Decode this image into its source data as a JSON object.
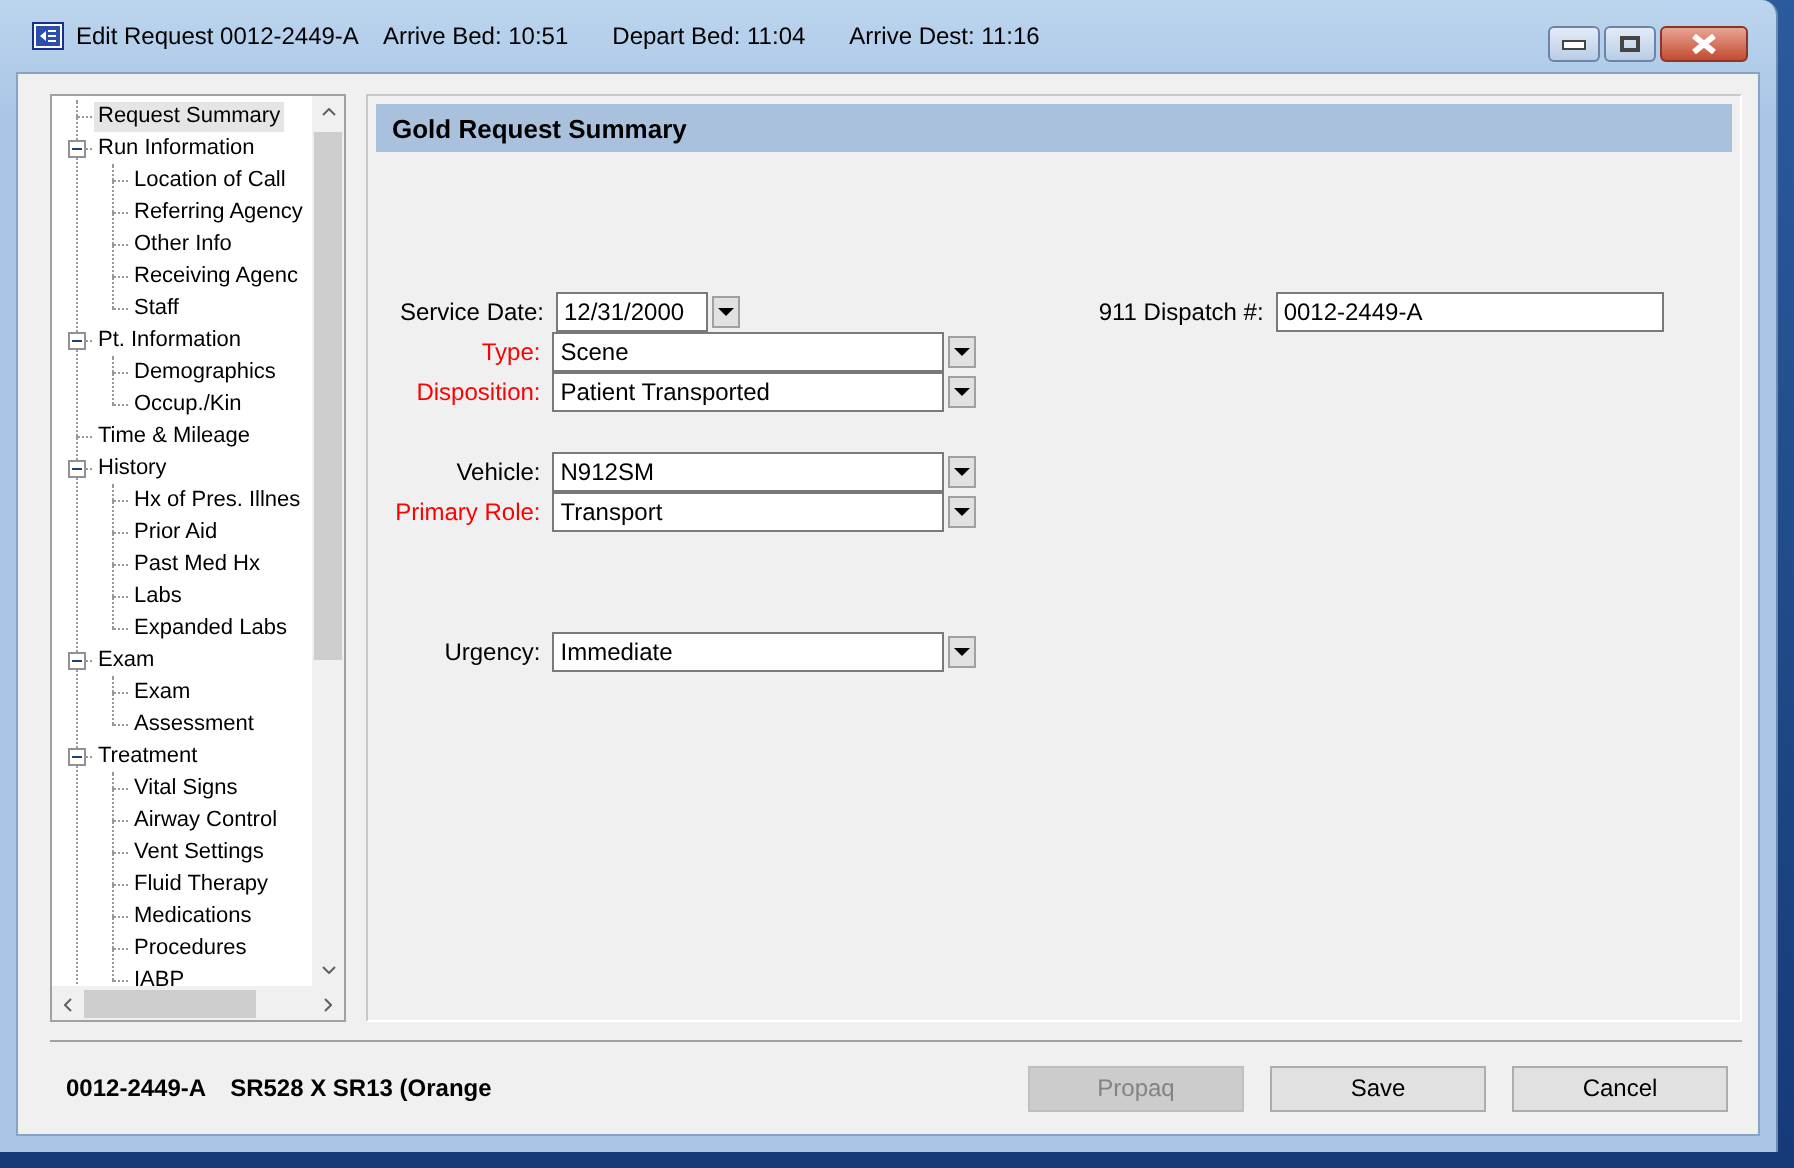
{
  "window": {
    "title": "Edit Request 0012-2449-A",
    "times": [
      "Arrive Bed: 10:51",
      "Depart Bed: 11:04",
      "Arrive Dest: 11:16"
    ]
  },
  "tree": {
    "items": [
      {
        "label": "Request Summary",
        "selected": true
      },
      {
        "label": "Run Information",
        "selected": false,
        "expanded": true,
        "children": [
          {
            "label": "Location of Call",
            "selected": false
          },
          {
            "label": "Referring Agency",
            "selected": false
          },
          {
            "label": "Other Info",
            "selected": false
          },
          {
            "label": "Receiving Agenc",
            "selected": false
          },
          {
            "label": "Staff",
            "selected": false
          }
        ]
      },
      {
        "label": "Pt. Information",
        "selected": false,
        "expanded": true,
        "children": [
          {
            "label": "Demographics",
            "selected": false
          },
          {
            "label": "Occup./Kin",
            "selected": false
          }
        ]
      },
      {
        "label": "Time & Mileage",
        "selected": false
      },
      {
        "label": "History",
        "selected": false,
        "expanded": true,
        "children": [
          {
            "label": "Hx of Pres. Illnes",
            "selected": false
          },
          {
            "label": "Prior Aid",
            "selected": false
          },
          {
            "label": "Past Med Hx",
            "selected": false
          },
          {
            "label": "Labs",
            "selected": false
          },
          {
            "label": "Expanded Labs",
            "selected": false
          }
        ]
      },
      {
        "label": "Exam",
        "selected": false,
        "expanded": true,
        "children": [
          {
            "label": "Exam",
            "selected": false
          },
          {
            "label": "Assessment",
            "selected": false
          }
        ]
      },
      {
        "label": "Treatment",
        "selected": false,
        "expanded": true,
        "children": [
          {
            "label": "Vital Signs",
            "selected": false
          },
          {
            "label": "Airway Control",
            "selected": false
          },
          {
            "label": "Vent Settings",
            "selected": false
          },
          {
            "label": "Fluid Therapy",
            "selected": false
          },
          {
            "label": "Medications",
            "selected": false
          },
          {
            "label": "Procedures",
            "selected": false
          },
          {
            "label": "IABP",
            "selected": false
          }
        ]
      }
    ]
  },
  "panel": {
    "title": "Gold Request Summary",
    "groups": [
      [
        {
          "label": "Service Date:",
          "value": "12/31/2000",
          "required": false,
          "kind": "date"
        },
        {
          "label": "Type:",
          "value": "Scene",
          "required": true,
          "kind": "combo"
        },
        {
          "label": "Disposition:",
          "value": "Patient Transported",
          "required": true,
          "kind": "combo"
        }
      ],
      [
        {
          "label": "Vehicle:",
          "value": "N912SM",
          "required": false,
          "kind": "combo"
        },
        {
          "label": "Primary Role:",
          "value": "Transport",
          "required": true,
          "kind": "combo"
        }
      ],
      [
        {
          "label": "Urgency:",
          "value": "Immediate",
          "required": false,
          "kind": "combo"
        }
      ]
    ],
    "dispatch": {
      "label": "911 Dispatch #:",
      "value": "0012-2449-A",
      "required": false,
      "kind": "text"
    }
  },
  "status_bar": {
    "texts": [
      "0012-2449-A",
      "SR528 X SR13 (Orange"
    ]
  },
  "buttons": [
    {
      "label": "Propaq",
      "disabled": true
    },
    {
      "label": "Save",
      "disabled": false
    },
    {
      "label": "Cancel",
      "disabled": false
    }
  ]
}
